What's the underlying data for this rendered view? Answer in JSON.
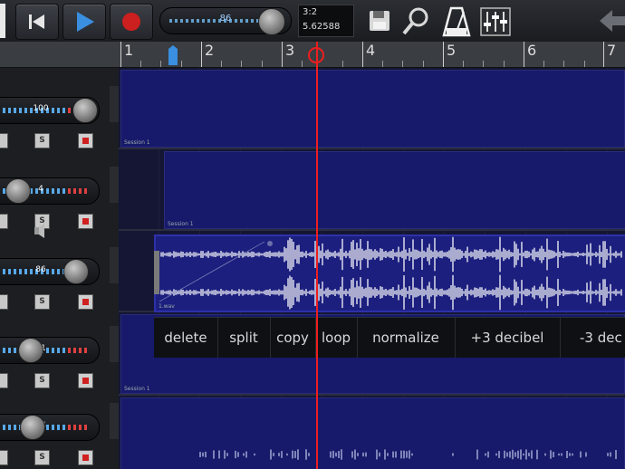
{
  "toolbar": {
    "master_volume": "86",
    "master_volume_level": 0.86,
    "position": {
      "bar_beat": "3:2",
      "seconds": "5.62588"
    },
    "icons": [
      "rewind-to-start-icon",
      "play-icon",
      "record-icon",
      "save-icon",
      "zoom-icon",
      "metronome-icon",
      "mixer-icon",
      "undo-icon"
    ]
  },
  "ruler": {
    "bars": [
      "1",
      "2",
      "3",
      "4",
      "5",
      "6",
      "7"
    ]
  },
  "mixer": {
    "tracks": [
      {
        "volume": "100",
        "volume_level": 0.85,
        "mute": "M",
        "solo": "S"
      },
      {
        "volume": "4",
        "volume_level": 0.15,
        "mute": "M",
        "solo": "S"
      },
      {
        "volume": "86",
        "volume_level": 0.75,
        "mute": "M",
        "solo": "S"
      },
      {
        "volume": "31",
        "volume_level": 0.28,
        "mute": "M",
        "solo": "S"
      },
      {
        "volume": "34",
        "volume_level": 0.3,
        "mute": "M",
        "solo": "S"
      }
    ]
  },
  "lanes": [
    {
      "label": "Session 1"
    },
    {
      "label": "Session 1"
    },
    {
      "label": "1.wav"
    },
    {
      "label": "Session 1"
    },
    {
      "label": ""
    }
  ],
  "edit_menu": {
    "items": [
      "delete",
      "split",
      "copy",
      "loop",
      "normalize",
      "+3 decibel",
      "-3 dec"
    ]
  },
  "colors": {
    "accent": "#3a8fe0",
    "playhead": "#ee1e1e",
    "record": "#cc1f1f",
    "region": "#17196a"
  }
}
